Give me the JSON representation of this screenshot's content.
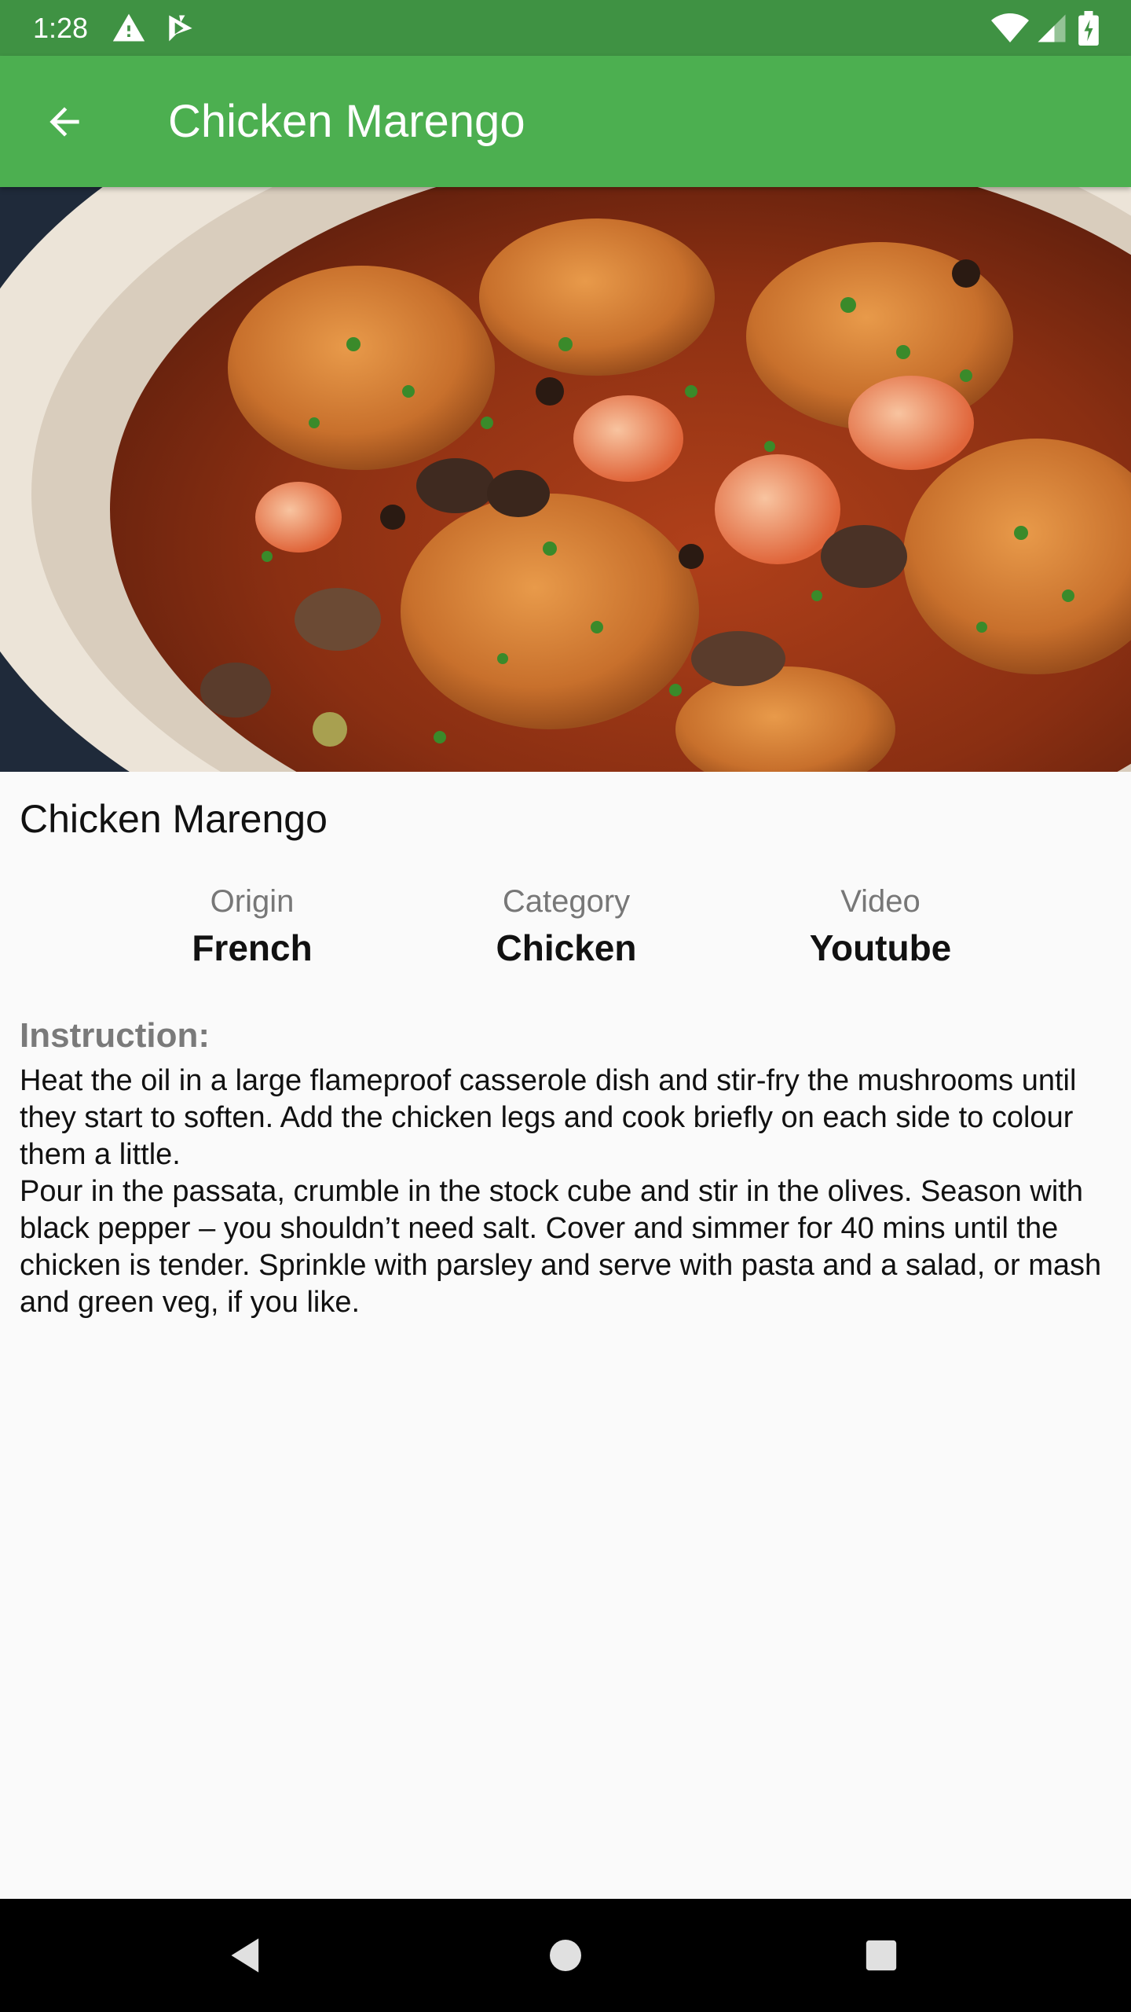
{
  "status_bar": {
    "time": "1:28",
    "icons": [
      "alert-icon",
      "play-store-icon",
      "wifi-icon",
      "signal-icon",
      "battery-icon"
    ]
  },
  "app_bar": {
    "title": "Chicken Marengo",
    "back_icon": "arrow-back-icon",
    "background_color": "#4caf50",
    "status_color": "#3f9243"
  },
  "meal": {
    "image_alt": "Chicken Marengo dish",
    "name": "Chicken Marengo",
    "origin_label": "Origin",
    "origin": "French",
    "category_label": "Category",
    "category": "Chicken",
    "video_label": "Video",
    "video": "Youtube"
  },
  "instructions": {
    "heading": "Instruction:",
    "paragraph_1": "Heat the oil in a large flameproof casserole dish and stir-fry the mushrooms until they start to soften. Add the chicken legs and cook briefly on each side to colour them a little.",
    "paragraph_2": "Pour in the passata, crumble in the stock cube and stir in the olives. Season with black pepper – you shouldn’t need salt. Cover and simmer for 40 mins until the chicken is tender. Sprinkle with parsley and serve with pasta and a salad, or mash and green veg, if you like."
  },
  "nav_bar": {
    "icons": [
      "back-triangle-icon",
      "home-circle-icon",
      "recents-square-icon"
    ]
  }
}
